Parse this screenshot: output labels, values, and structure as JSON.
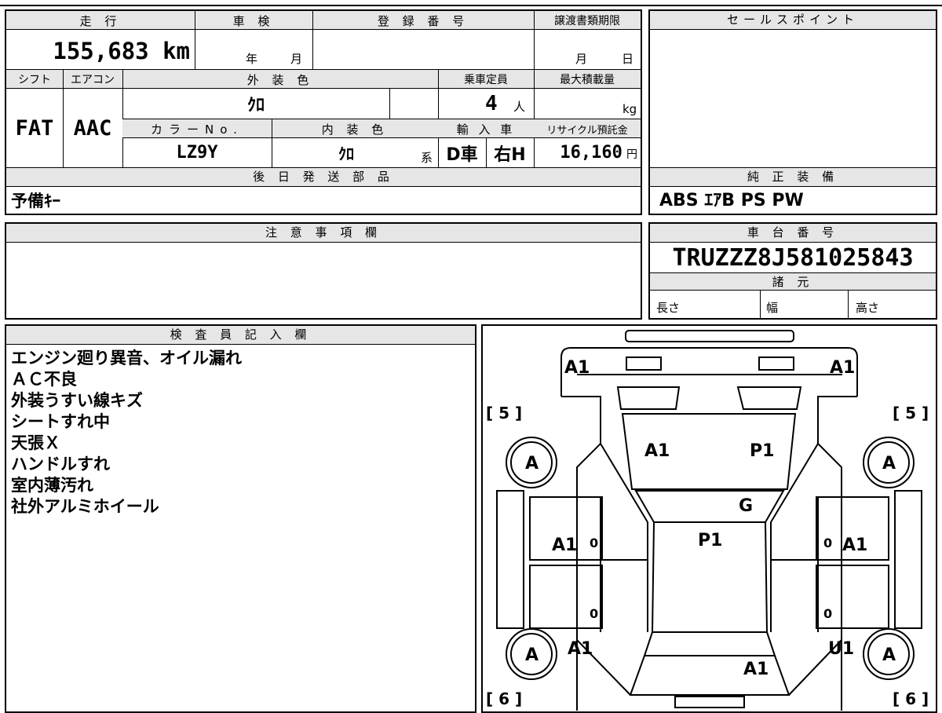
{
  "top_header": {
    "mileage_label": "走 行",
    "shaken_label": "車 検",
    "reg_no_label": "登 録 番 号",
    "transfer_label": "譲渡書類期限",
    "sales_point_label": "セールスポイント"
  },
  "mileage": {
    "value": "155,683",
    "unit": "km"
  },
  "shaken": {
    "year": "年",
    "month": "月"
  },
  "transfer_deadline": {
    "month": "月",
    "day": "日"
  },
  "row2_labels": {
    "shift": "シフト",
    "aircon": "エアコン",
    "exterior_color": "外 装 色",
    "capacity": "乗車定員",
    "max_load": "最大積載量"
  },
  "shift": "FAT",
  "aircon": "AAC",
  "exterior_color_value": "ｸﾛ",
  "capacity": {
    "value": "4",
    "unit": "人"
  },
  "max_load_unit": "kg",
  "row3_labels": {
    "color_no": "カラーNo.",
    "interior_color": "内 装 色",
    "import": "輸 入 車",
    "recycle": "リサイクル預託金"
  },
  "color_no": "LZ9Y",
  "interior_color": {
    "value": "ｸﾛ",
    "suffix": "系"
  },
  "import_car": {
    "dealer": "D車",
    "handle": "右H"
  },
  "recycle": {
    "value": "16,160",
    "unit": "円"
  },
  "later_parts": {
    "label": "後 日 発 送 部 品",
    "value": "予備ｷｰ"
  },
  "genuine_equipment": {
    "label": "純 正 装 備",
    "value": "ABS ｴｱB PS PW"
  },
  "cautions": {
    "label": "注 意 事 項 欄"
  },
  "chassis": {
    "label": "車 台 番 号",
    "value": "TRUZZZ8J581025843"
  },
  "specs": {
    "label": "諸 元",
    "length": "長さ",
    "width": "幅",
    "height": "高さ"
  },
  "inspector": {
    "label": "検 査 員 記 入 欄",
    "notes": [
      "エンジン廻り異音、オイル漏れ",
      "ＡＣ不良",
      "外装うすい線キズ",
      "シートすれ中",
      "天張Ｘ",
      "ハンドルすれ",
      "室内薄汚れ",
      "社外アルミホイール"
    ]
  },
  "diagram": {
    "front_left": "A1",
    "front_right": "A1",
    "bracket_tl": "[ 5 ]",
    "bracket_tr": "[ 5 ]",
    "bracket_bl": "[ 6 ]",
    "bracket_br": "[ 6 ]",
    "tire": "A",
    "hood_left": "A1",
    "hood_right": "P1",
    "windshield": "G",
    "roof": "P1",
    "door_left": "A1",
    "door_right": "A1",
    "door_num": "0",
    "rear_left": "A1",
    "rear_right": "U1",
    "trunk": "A1"
  }
}
